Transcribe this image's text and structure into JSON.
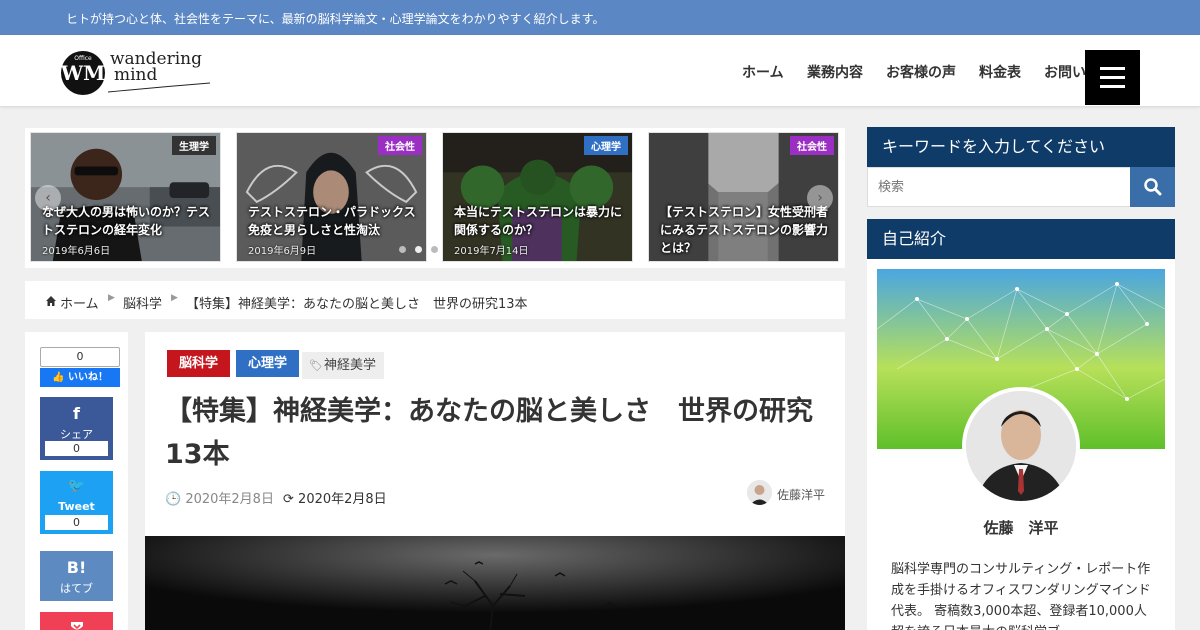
{
  "site": {
    "tagline": "ヒトが持つ心と体、社会性をテーマに、最新の脳科学論文・心理学論文をわかりやすく紹介します。",
    "logo_text_1": "wandering",
    "logo_text_2": "mind",
    "logo_small": "Office",
    "logo_mark": "WM"
  },
  "nav": {
    "items": [
      "ホーム",
      "業務内容",
      "お客様の声",
      "料金表",
      "お問い合わせ"
    ]
  },
  "slider": {
    "slides": [
      {
        "tag": "生理学",
        "tag_color": "#333333",
        "title": "なぜ大人の男は怖いのか？テストステロンの経年変化",
        "date": "2019年6月6日"
      },
      {
        "tag": "社会性",
        "tag_color": "#9b2fc4",
        "title": "テストステロン・パラドックス　免疫と男らしさと性淘汰",
        "date": "2019年6月9日"
      },
      {
        "tag": "心理学",
        "tag_color": "#2f6fc4",
        "title": "本当にテストステロンは暴力に関係するのか？",
        "date": "2019年7月14日"
      },
      {
        "tag": "社会性",
        "tag_color": "#9b2fc4",
        "title": "【テストステロン】女性受刑者にみるテストステロンの影響力とは？",
        "date": ""
      }
    ],
    "prev": "‹",
    "next": "›"
  },
  "breadcrumb": {
    "home": "ホーム",
    "category": "脳科学",
    "current": "【特集】神経美学：あなたの脳と美しさ　世界の研究13本"
  },
  "share": {
    "fb_like_count": "0",
    "fb_like_label": "いいね！",
    "facebook_icon": "f",
    "facebook_label": "シェア",
    "facebook_count": "0",
    "twitter_icon": "🐦",
    "twitter_label": "Tweet",
    "twitter_count": "0",
    "hatena_icon": "B!",
    "hatena_label": "はてブ"
  },
  "article": {
    "categories": [
      {
        "label": "脳科学",
        "color": "#c4161c"
      },
      {
        "label": "心理学",
        "color": "#2f6fc4"
      }
    ],
    "tag": "神経美学",
    "title": "【特集】神経美学：あなたの脳と美しさ　世界の研究13本",
    "published": "2020年2月8日",
    "updated": "2020年2月8日",
    "author": "佐藤洋平"
  },
  "sidebar": {
    "search_heading": "キーワードを入力してください",
    "search_placeholder": "検索",
    "profile_heading": "自己紹介",
    "profile_name": "佐藤　洋平",
    "profile_bio": "脳科学専門のコンサルティング・レポート作成を手掛けるオフィスワンダリングマインド代表。 寄稿数3,000本超、登録者10,000人超を誇る日本最大の脳科学ブ"
  }
}
